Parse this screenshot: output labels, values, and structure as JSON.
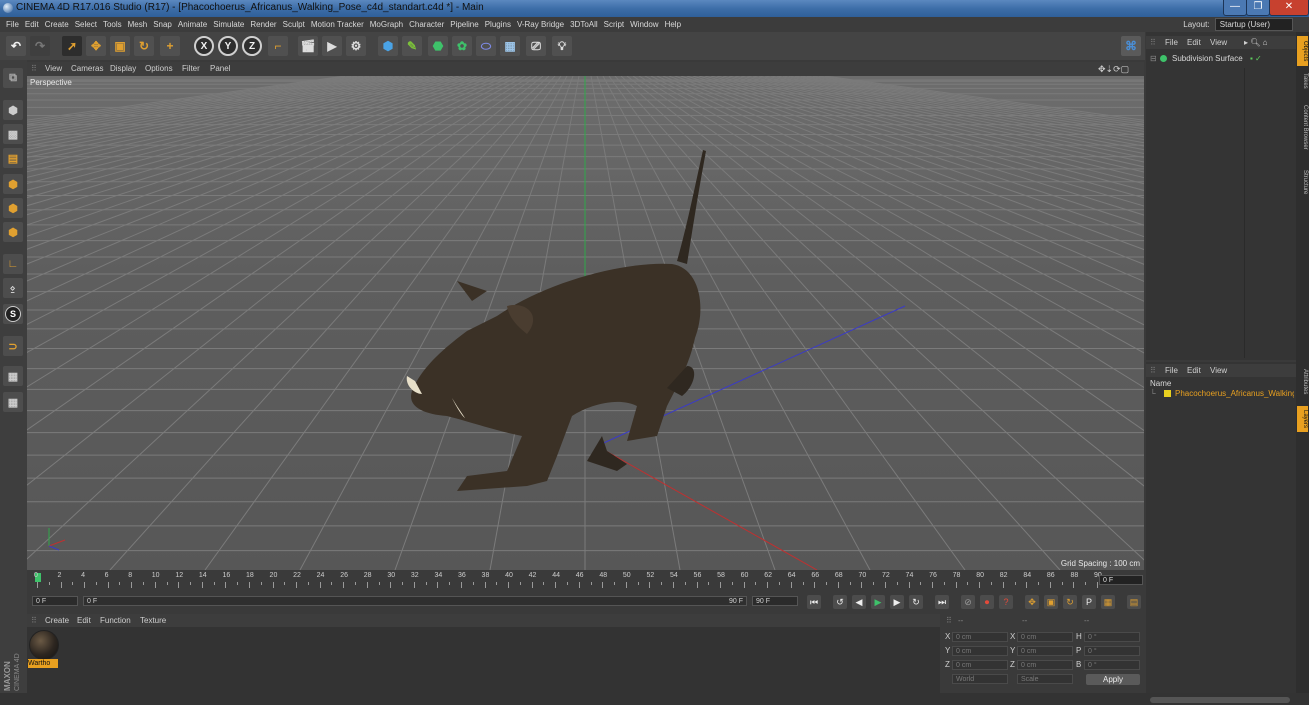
{
  "window": {
    "title": "CINEMA 4D R17.016 Studio (R17) - [Phacochoerus_Africanus_Walking_Pose_c4d_standart.c4d *] - Main",
    "minimize": "—",
    "maximize": "❐",
    "close": "✕"
  },
  "menu": [
    "File",
    "Edit",
    "Create",
    "Select",
    "Tools",
    "Mesh",
    "Snap",
    "Animate",
    "Simulate",
    "Render",
    "Sculpt",
    "Motion Tracker",
    "MoGraph",
    "Character",
    "Pipeline",
    "Plugins",
    "V-Ray Bridge",
    "3DToAll",
    "Script",
    "Window",
    "Help"
  ],
  "layout": {
    "label": "Layout:",
    "value": "Startup (User)"
  },
  "toolbar": {
    "axis_x": "X",
    "axis_y": "Y",
    "axis_z": "Z"
  },
  "viewport": {
    "menu": [
      "View",
      "Cameras",
      "Display",
      "Options",
      "Filter",
      "Panel"
    ],
    "camera": "Perspective",
    "grid_spacing": "Grid Spacing : 100 cm"
  },
  "timeline": {
    "ticks": [
      "0",
      "2",
      "4",
      "6",
      "8",
      "10",
      "12",
      "14",
      "16",
      "18",
      "20",
      "22",
      "24",
      "26",
      "28",
      "30",
      "32",
      "34",
      "36",
      "38",
      "40",
      "42",
      "44",
      "46",
      "48",
      "50",
      "52",
      "54",
      "56",
      "58",
      "60",
      "62",
      "64",
      "66",
      "68",
      "70",
      "72",
      "74",
      "76",
      "78",
      "80",
      "82",
      "84",
      "86",
      "88",
      "90"
    ],
    "end_field": "0 F"
  },
  "playback": {
    "current": "0 F",
    "range_start": "0 F",
    "range_end": "90 F",
    "max": "90 F"
  },
  "materials": {
    "menu": [
      "Create",
      "Edit",
      "Function",
      "Texture"
    ],
    "items": [
      {
        "name": "Wartho"
      }
    ]
  },
  "coordinates": {
    "header_dashes": [
      "--",
      "--",
      "--"
    ],
    "rows": [
      {
        "a": "X",
        "av": "0 cm",
        "b": "X",
        "bv": "0 cm",
        "c": "H",
        "cv": "0 °"
      },
      {
        "a": "Y",
        "av": "0 cm",
        "b": "Y",
        "bv": "0 cm",
        "c": "P",
        "cv": "0 °"
      },
      {
        "a": "Z",
        "av": "0 cm",
        "b": "Z",
        "bv": "0 cm",
        "c": "B",
        "cv": "0 °"
      }
    ],
    "space": "World",
    "mode": "Scale",
    "apply": "Apply"
  },
  "objects": {
    "menu": [
      "File",
      "Edit",
      "View"
    ],
    "items": [
      {
        "name": "Subdivision Surface"
      }
    ]
  },
  "layers": {
    "menu": [
      "File",
      "Edit",
      "View"
    ],
    "column": "Name",
    "items": [
      {
        "name": "Phacochoerus_Africanus_Walking"
      }
    ]
  },
  "side_tabs": [
    "Objects",
    "Takes",
    "Content Browser",
    "Structure"
  ],
  "side_tabs_lower": [
    "Attributes",
    "Layers"
  ],
  "colors": {
    "accent": "#e8a020",
    "green_axis": "#2fa84a",
    "blue_axis": "#3a3ac8",
    "red_axis": "#c03030"
  }
}
